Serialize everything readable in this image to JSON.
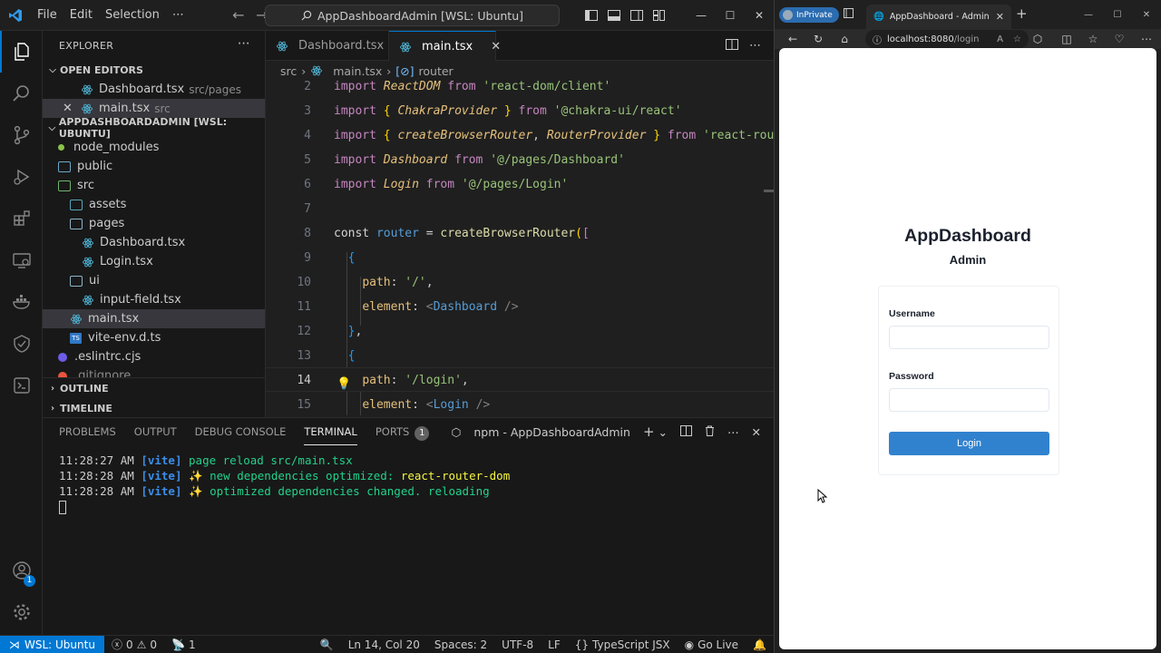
{
  "vscode": {
    "menu": [
      "File",
      "Edit",
      "Selection"
    ],
    "command_center": "AppDashboardAdmin [WSL: Ubuntu]",
    "explorer": {
      "title": "EXPLORER",
      "open_editors_label": "OPEN EDITORS",
      "open_editors": [
        {
          "name": "Dashboard.tsx",
          "desc": "src/pages"
        },
        {
          "name": "main.tsx",
          "desc": "src"
        }
      ],
      "workspace_label": "APPDASHBOARDADMIN [WSL: UBUNTU]",
      "tree": [
        {
          "name": "node_modules",
          "kind": "dot",
          "indent": 1
        },
        {
          "name": "public",
          "kind": "folder-public",
          "indent": 1
        },
        {
          "name": "src",
          "kind": "folder-src",
          "indent": 1
        },
        {
          "name": "assets",
          "kind": "folder-assets",
          "indent": 2
        },
        {
          "name": "pages",
          "kind": "folder",
          "indent": 2
        },
        {
          "name": "Dashboard.tsx",
          "kind": "react",
          "indent": 3
        },
        {
          "name": "Login.tsx",
          "kind": "react",
          "indent": 3
        },
        {
          "name": "ui",
          "kind": "folder",
          "indent": 2
        },
        {
          "name": "input-field.tsx",
          "kind": "react",
          "indent": 3
        },
        {
          "name": "main.tsx",
          "kind": "react",
          "indent": 2,
          "selected": true
        },
        {
          "name": "vite-env.d.ts",
          "kind": "ts",
          "indent": 2
        },
        {
          "name": ".eslintrc.cjs",
          "kind": "eslint",
          "indent": 1
        },
        {
          "name": ".gitignore",
          "kind": "git",
          "indent": 1
        }
      ],
      "outline_label": "OUTLINE",
      "timeline_label": "TIMELINE"
    },
    "tabs": [
      {
        "label": "Dashboard.tsx",
        "active": false
      },
      {
        "label": "main.tsx",
        "active": true
      }
    ],
    "breadcrumb": [
      "src",
      "main.tsx",
      "router"
    ],
    "code_lines": [
      {
        "n": "2"
      },
      {
        "n": "3"
      },
      {
        "n": "4"
      },
      {
        "n": "5"
      },
      {
        "n": "6"
      },
      {
        "n": "7"
      },
      {
        "n": "8"
      },
      {
        "n": "9"
      },
      {
        "n": "10"
      },
      {
        "n": "11"
      },
      {
        "n": "12"
      },
      {
        "n": "13"
      },
      {
        "n": "14"
      },
      {
        "n": "15"
      }
    ],
    "panel": {
      "tabs": [
        "PROBLEMS",
        "OUTPUT",
        "DEBUG CONSOLE",
        "TERMINAL",
        "PORTS"
      ],
      "ports_count": "1",
      "terminal_name": "npm - AppDashboardAdmin",
      "lines": [
        {
          "time": "11:28:27 AM",
          "tag": "[vite]",
          "text": "page reload src/main.tsx",
          "dep": ""
        },
        {
          "time": "11:28:28 AM",
          "tag": "[vite]",
          "text": "✨ new dependencies optimized: ",
          "dep": "react-router-dom"
        },
        {
          "time": "11:28:28 AM",
          "tag": "[vite]",
          "text": "✨ optimized dependencies changed. reloading",
          "dep": ""
        }
      ]
    },
    "status": {
      "remote": "WSL: Ubuntu",
      "errors": "0",
      "warnings": "0",
      "ports": "1",
      "position": "Ln 14, Col 20",
      "spaces": "Spaces: 2",
      "encoding": "UTF-8",
      "eol": "LF",
      "language": "TypeScript JSX",
      "golive": "Go Live"
    },
    "accounts_badge": "1"
  },
  "browser": {
    "inprivate_label": "InPrivate",
    "tab_title": "AppDashboard - Admin",
    "url_host": "localhost:8080",
    "url_path": "/login",
    "page": {
      "title": "AppDashboard",
      "subtitle": "Admin",
      "username_label": "Username",
      "username_value": "",
      "password_label": "Password",
      "password_value": "",
      "login_button": "Login"
    }
  },
  "colors": {
    "accent": "#0078d4",
    "login_button": "#3182ce"
  }
}
